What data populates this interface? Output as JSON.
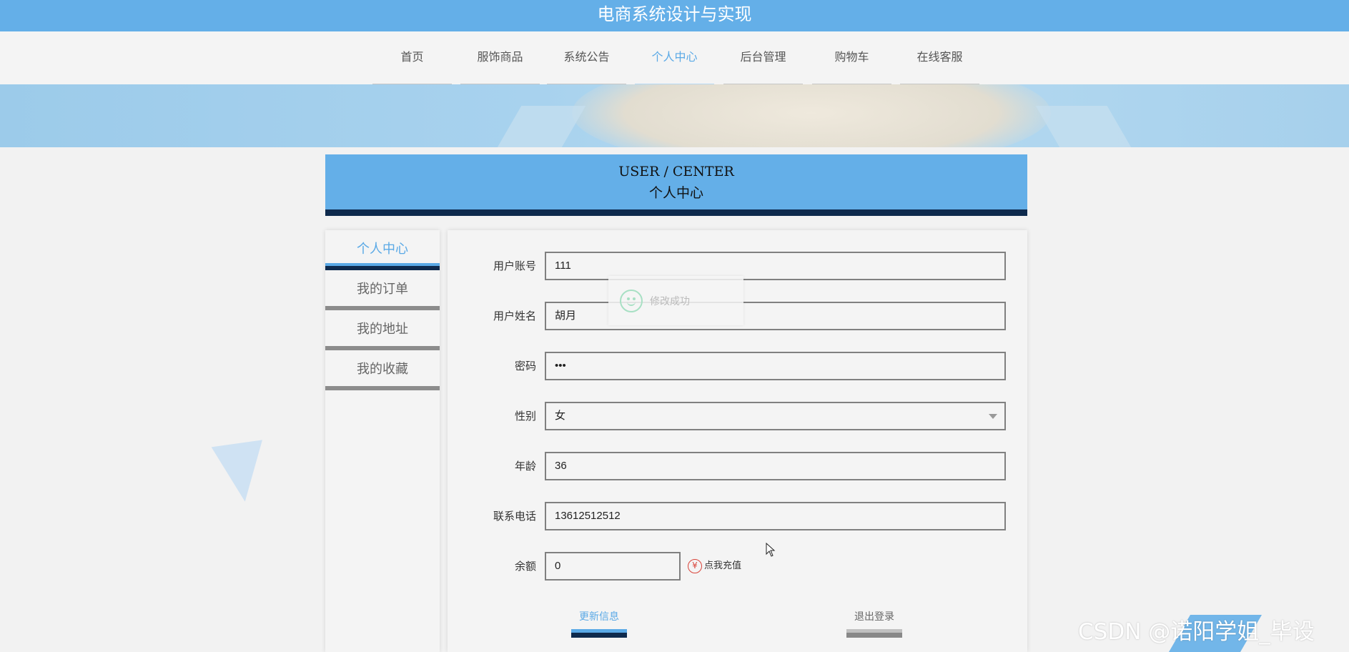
{
  "app": {
    "title": "电商系统设计与实现"
  },
  "nav": {
    "items": [
      {
        "label": "首页",
        "active": false
      },
      {
        "label": "服饰商品",
        "active": false
      },
      {
        "label": "系统公告",
        "active": false
      },
      {
        "label": "个人中心",
        "active": true
      },
      {
        "label": "后台管理",
        "active": false
      },
      {
        "label": "购物车",
        "active": false
      },
      {
        "label": "在线客服",
        "active": false
      }
    ]
  },
  "header": {
    "title_en": "USER / CENTER",
    "title_cn": "个人中心"
  },
  "sidebar": {
    "items": [
      {
        "label": "个人中心",
        "active": true
      },
      {
        "label": "我的订单",
        "active": false
      },
      {
        "label": "我的地址",
        "active": false
      },
      {
        "label": "我的收藏",
        "active": false
      }
    ]
  },
  "form": {
    "account": {
      "label": "用户账号",
      "value": "111"
    },
    "name": {
      "label": "用户姓名",
      "value": "胡月"
    },
    "password": {
      "label": "密码",
      "value": "•••"
    },
    "gender": {
      "label": "性别",
      "value": "女"
    },
    "age": {
      "label": "年龄",
      "value": "36"
    },
    "phone": {
      "label": "联系电话",
      "value": "13612512512"
    },
    "balance": {
      "label": "余额",
      "value": "0"
    },
    "recharge_label": "点我充值",
    "recharge_icon": "¥",
    "update_button": "更新信息",
    "logout_button": "退出登录"
  },
  "toast": {
    "message": "修改成功"
  },
  "watermark": "CSDN @诺阳学姐_毕设",
  "colors": {
    "accent": "#64afe8",
    "dark": "#0e2a4d"
  }
}
